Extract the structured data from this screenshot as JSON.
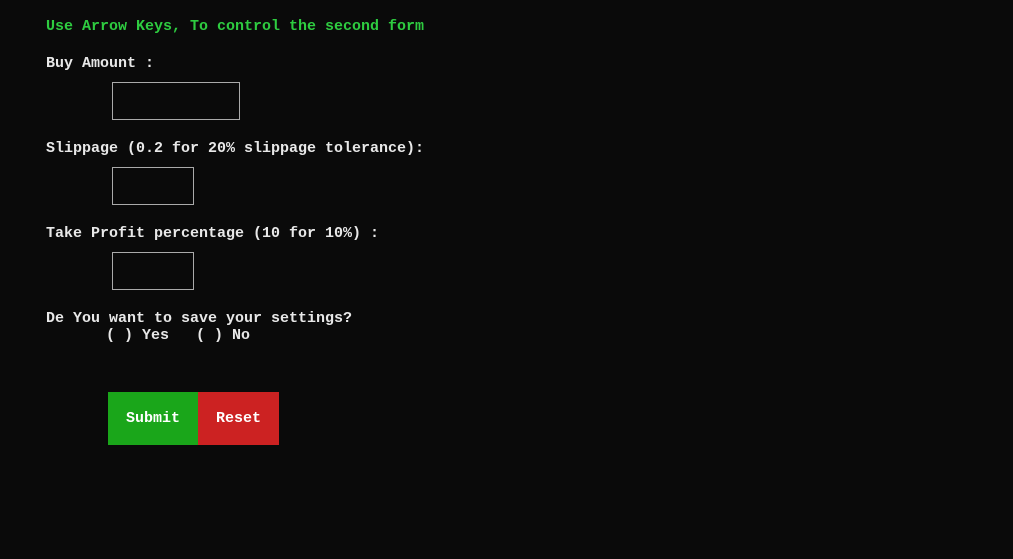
{
  "header": "Use Arrow Keys, To control the second form",
  "fields": {
    "buy_amount": {
      "label": "Buy Amount :",
      "value": ""
    },
    "slippage": {
      "label": "Slippage (0.2 for 20% slippage tolerance):",
      "value": ""
    },
    "take_profit": {
      "label": "Take Profit percentage (10 for 10%) :",
      "value": ""
    },
    "save_settings": {
      "label": "De You want to save your settings?",
      "options": {
        "yes": "( ) Yes",
        "no": "( ) No"
      }
    }
  },
  "buttons": {
    "submit": "Submit",
    "reset": "Reset"
  }
}
